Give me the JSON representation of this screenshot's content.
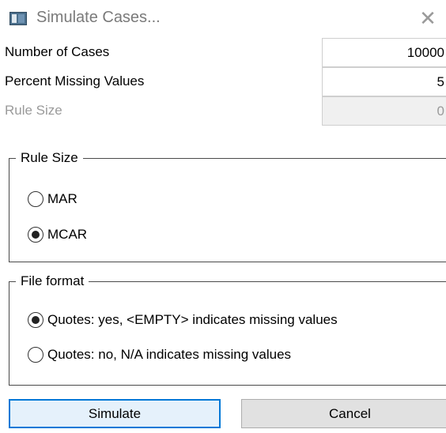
{
  "window": {
    "title": "Simulate Cases...",
    "close_icon": "close-icon",
    "app_icon": "window-app-icon"
  },
  "fields": {
    "number_of_cases": {
      "label": "Number of Cases",
      "value": "10000"
    },
    "percent_missing": {
      "label": "Percent Missing Values",
      "value": "5"
    },
    "rule_size": {
      "label": "Rule Size",
      "value": "0",
      "disabled": true
    }
  },
  "rule_size_group": {
    "legend": "Rule Size",
    "options": [
      {
        "label": "MAR",
        "checked": false
      },
      {
        "label": "MCAR",
        "checked": true
      }
    ]
  },
  "file_format_group": {
    "legend": "File format",
    "options": [
      {
        "label": "Quotes: yes, <EMPTY> indicates missing values",
        "checked": true
      },
      {
        "label": "Quotes: no, N/A indicates missing values",
        "checked": false
      }
    ]
  },
  "buttons": {
    "simulate": "Simulate",
    "cancel": "Cancel"
  },
  "colors": {
    "default_button_border": "#0078d7",
    "default_button_bg": "#e5f1fb",
    "button_bg": "#e1e1e1"
  }
}
